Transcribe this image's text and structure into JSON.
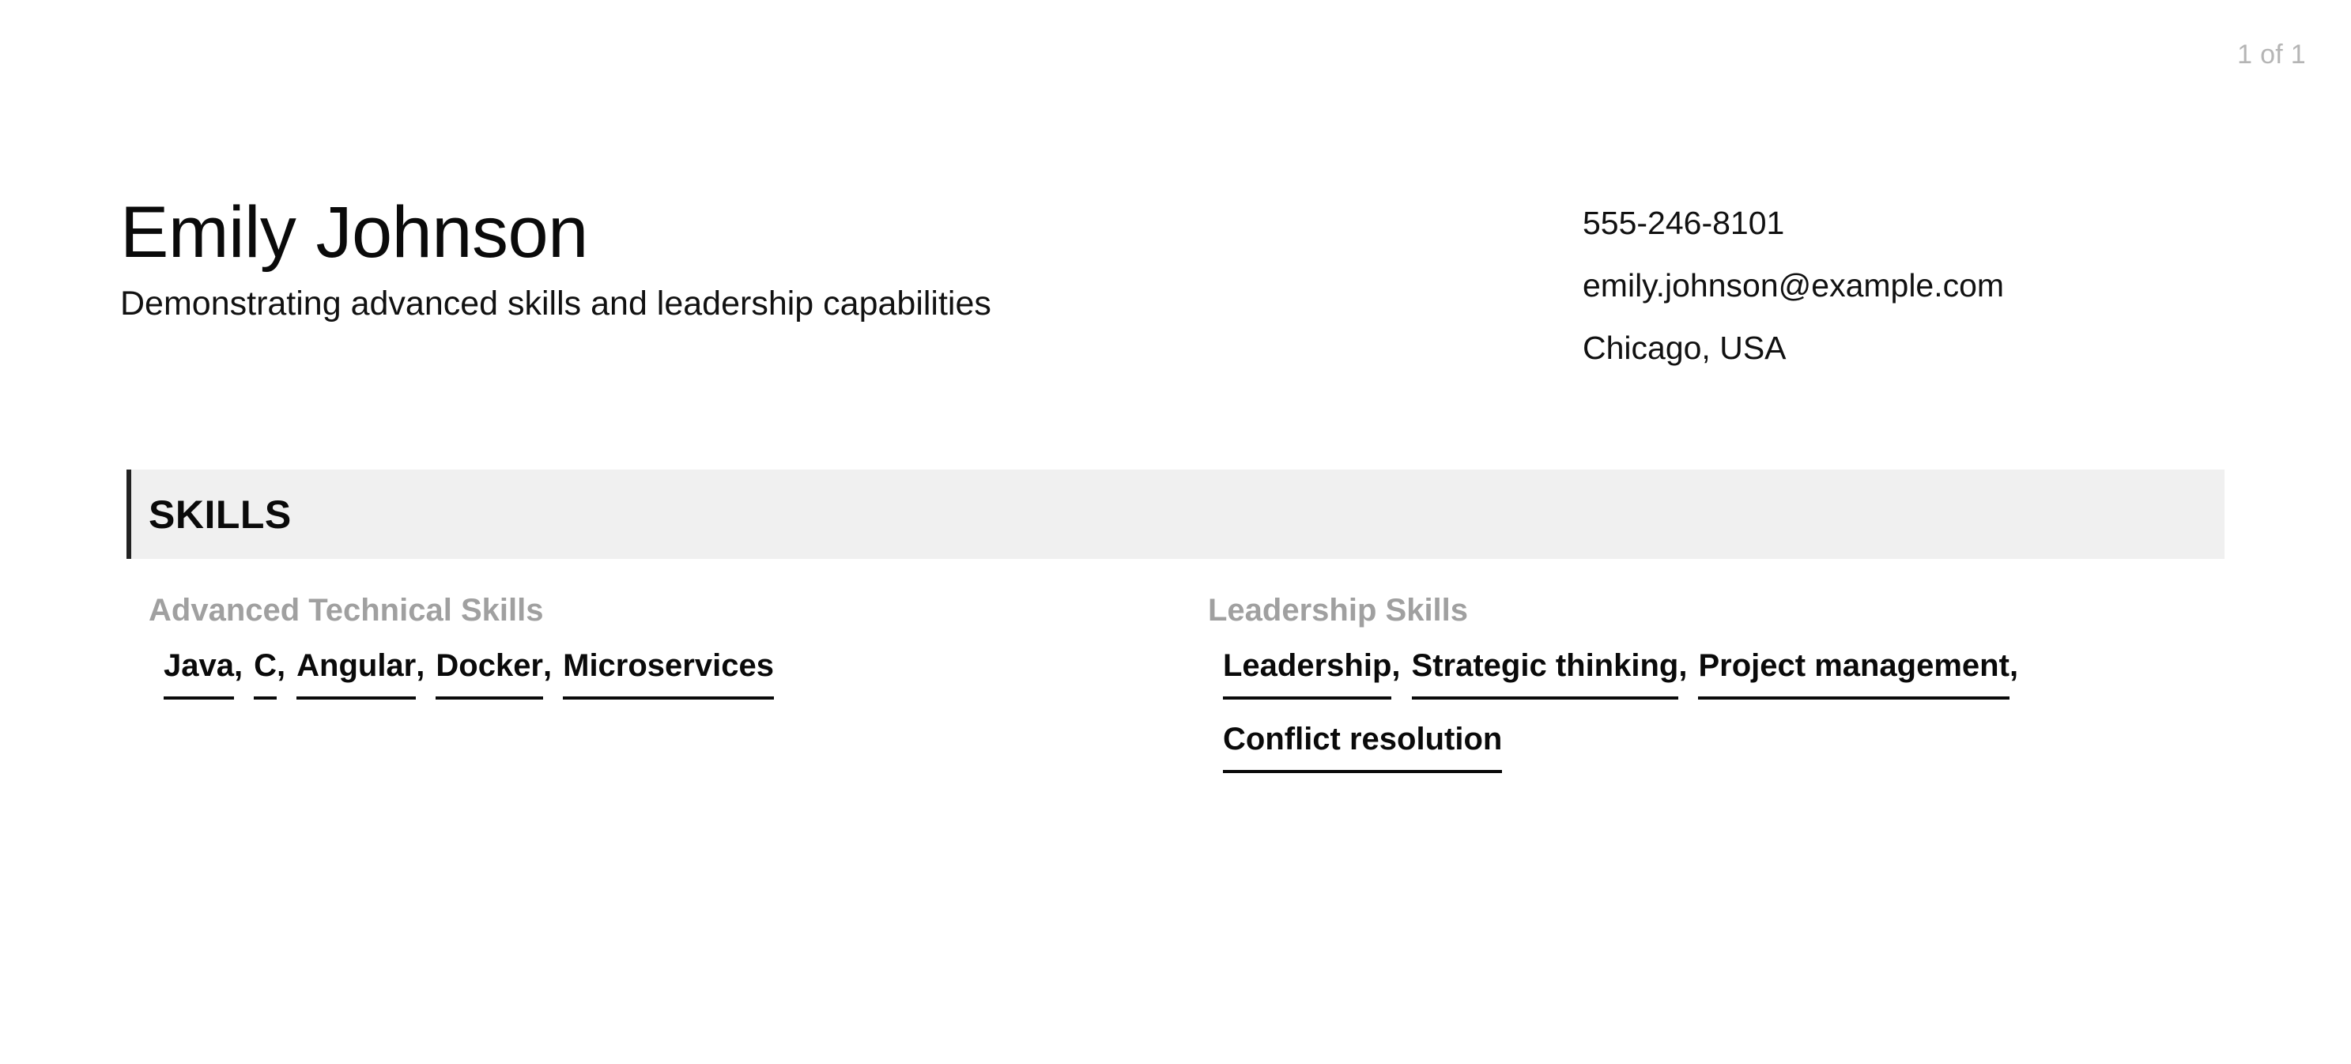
{
  "viewer": {
    "page_indicator": "1 of 1"
  },
  "header": {
    "name": "Emily Johnson",
    "tagline": "Demonstrating advanced skills and leadership capabilities",
    "contact": {
      "phone": "555-246-8101",
      "email": "emily.johnson@example.com",
      "location": "Chicago, USA"
    }
  },
  "section": {
    "title": "SKILLS",
    "accent_color": "#222222",
    "bar_background": "#f0f0f0"
  },
  "skills": {
    "groups": [
      {
        "heading": "Advanced Technical Skills",
        "items": [
          {
            "label": "Java",
            "separator": ","
          },
          {
            "label": "C",
            "separator": ","
          },
          {
            "label": "Angular",
            "separator": ","
          },
          {
            "label": "Docker",
            "separator": ","
          },
          {
            "label": "Microservices",
            "separator": ""
          }
        ]
      },
      {
        "heading": "Leadership Skills",
        "items": [
          {
            "label": "Leadership",
            "separator": ","
          },
          {
            "label": "Strategic thinking",
            "separator": ","
          },
          {
            "label": "Project management",
            "separator": ","
          },
          {
            "label": "Conflict resolution",
            "separator": ""
          }
        ]
      }
    ]
  }
}
